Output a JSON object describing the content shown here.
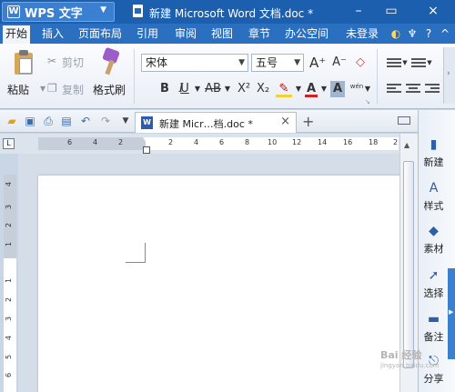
{
  "titlebar": {
    "app_name": "WPS 文字",
    "doc_title": "新建 Microsoft Word 文档.doc *",
    "close_glyph": "×"
  },
  "menu": {
    "items": [
      "开始",
      "插入",
      "页面布局",
      "引用",
      "审阅",
      "视图",
      "章节",
      "办公空间"
    ],
    "login": "未登录"
  },
  "ribbon": {
    "paste": "粘贴",
    "cut": "剪切",
    "copy": "复制",
    "format_painter": "格式刷",
    "font_name": "宋体",
    "font_size": "五号",
    "grow_font": "A⁺",
    "shrink_font": "A⁻",
    "bold": "B",
    "italic": "I",
    "underline": "U",
    "strike": "AB",
    "superscript": "X²",
    "subscript": "X₂",
    "phonetic": "wén"
  },
  "tabs": {
    "doc_tab_label": "新建 Micr…档.doc *",
    "close": "×",
    "new_tab": "+"
  },
  "ruler": {
    "h_ticks": [
      "6",
      "4",
      "2",
      "2",
      "4",
      "6",
      "8",
      "10",
      "12",
      "14",
      "16",
      "18",
      "2"
    ],
    "v_ticks": [
      "4",
      "3",
      "2",
      "1",
      "1",
      "2",
      "3",
      "4",
      "5",
      "6"
    ],
    "corner": "L"
  },
  "side_panel": {
    "items": [
      "新建",
      "样式",
      "素材",
      "选择",
      "备注",
      "分享"
    ]
  },
  "watermark": {
    "text": "Bai 经验",
    "sub": "jingyan.baidu.com"
  }
}
